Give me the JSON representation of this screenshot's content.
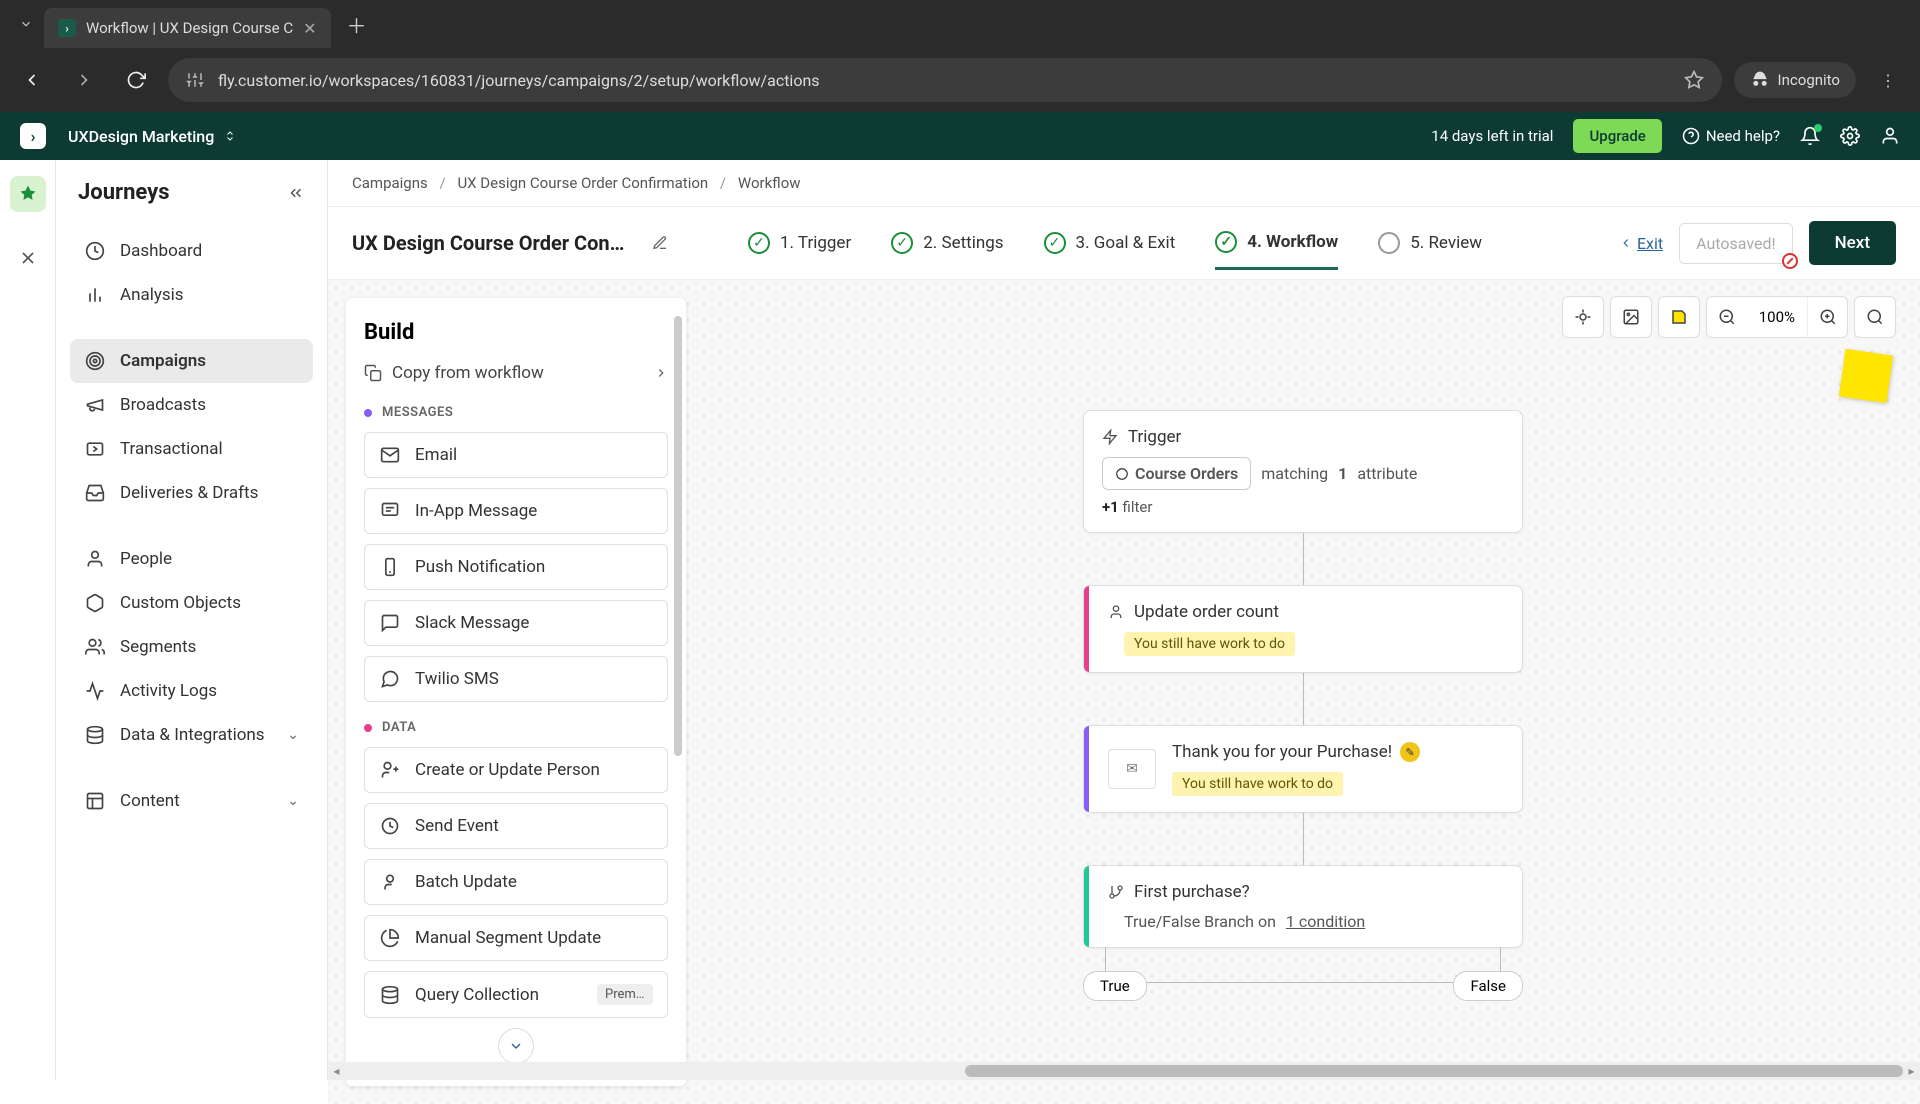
{
  "browser": {
    "tab_title": "Workflow | UX Design Course C",
    "url": "fly.customer.io/workspaces/160831/journeys/campaigns/2/setup/workflow/actions",
    "incognito": "Incognito"
  },
  "topbar": {
    "workspace": "UXDesign Marketing",
    "trial": "14 days left in trial",
    "upgrade": "Upgrade",
    "help": "Need help?"
  },
  "sidebar": {
    "title": "Journeys",
    "items": [
      {
        "label": "Dashboard"
      },
      {
        "label": "Analysis"
      },
      {
        "label": "Campaigns"
      },
      {
        "label": "Broadcasts"
      },
      {
        "label": "Transactional"
      },
      {
        "label": "Deliveries & Drafts"
      },
      {
        "label": "People"
      },
      {
        "label": "Custom Objects"
      },
      {
        "label": "Segments"
      },
      {
        "label": "Activity Logs"
      },
      {
        "label": "Data & Integrations"
      },
      {
        "label": "Content"
      }
    ]
  },
  "breadcrumb": {
    "a": "Campaigns",
    "b": "UX Design Course Order Confirmation",
    "c": "Workflow"
  },
  "header": {
    "campaign_name": "UX Design Course Order Confir…",
    "steps": {
      "s1": "1. Trigger",
      "s2": "2. Settings",
      "s3": "3. Goal & Exit",
      "s4": "4. Workflow",
      "s5": "5. Review"
    },
    "exit": "Exit",
    "autosaved": "Autosaved!",
    "next": "Next"
  },
  "build": {
    "title": "Build",
    "copy": "Copy from workflow",
    "messages_label": "MESSAGES",
    "data_label": "DATA",
    "messages": {
      "email": "Email",
      "inapp": "In-App Message",
      "push": "Push Notification",
      "slack": "Slack Message",
      "twilio": "Twilio SMS"
    },
    "data_items": {
      "create_person": "Create or Update Person",
      "send_event": "Send Event",
      "batch": "Batch Update",
      "segment": "Manual Segment Update",
      "query": "Query Collection",
      "premium": "Premi…"
    }
  },
  "canvas": {
    "zoom": "100%",
    "trigger": {
      "title": "Trigger",
      "pill": "Course Orders",
      "matching": "matching",
      "count": "1",
      "attribute": "attribute",
      "more_prefix": "+1",
      "more": "filter"
    },
    "node2": {
      "title": "Update order count",
      "warn": "You still have work to do"
    },
    "node3": {
      "title": "Thank you for your Purchase!",
      "warn": "You still have work to do"
    },
    "node4": {
      "title": "First purchase?",
      "desc_a": "True/False Branch on ",
      "desc_b": "1 condition"
    },
    "branch_true": "True",
    "branch_false": "False"
  }
}
